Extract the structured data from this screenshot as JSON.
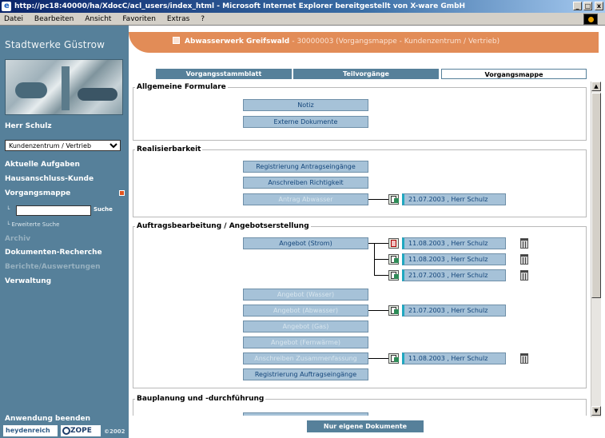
{
  "window": {
    "title": "http://pc18:40000/ha/XdocC/acl_users/index_html - Microsoft Internet Explorer bereitgestellt von X-ware GmbH",
    "minimize": "_",
    "maximize": "□",
    "close": "x"
  },
  "menu": {
    "items": [
      "Datei",
      "Bearbeiten",
      "Ansicht",
      "Favoriten",
      "Extras",
      "?"
    ]
  },
  "sidebar": {
    "brand": "Stadtwerke Güstrow",
    "user": "Herr Schulz",
    "select_value": "Kundenzentrum / Vertrieb",
    "nav": {
      "aktuelle_aufgaben": "Aktuelle Aufgaben",
      "hausanschluss": "Hausanschluss-Kunde",
      "vorgangsmappe": "Vorgangsmappe",
      "search_button": "Suche",
      "erweiterte_suche": "Erweiterte Suche",
      "archiv": "Archiv",
      "dokumenten_recherche": "Dokumenten-Recherche",
      "berichte": "Berichte/Auswertungen",
      "verwaltung": "Verwaltung"
    },
    "exit": "Anwendung beenden",
    "logo1": "heydenreich",
    "logo2": "ZOPE",
    "year": "©2002"
  },
  "header": {
    "title": "Abwasserwerk Greifswald",
    "subtitle": "- 30000003 (Vorgangsmappe - Kundenzentrum / Vertrieb)",
    "accent": "#e28c57"
  },
  "tabs": [
    {
      "label": "Vorgangsstammblatt",
      "active": false
    },
    {
      "label": "Teilvorgänge",
      "active": false
    },
    {
      "label": "Vorgangsmappe",
      "active": true
    }
  ],
  "groups": {
    "allgemein": {
      "title": "Allgemeine Formulare",
      "buttons": [
        "Notiz",
        "Externe Dokumente"
      ]
    },
    "realisierbarkeit": {
      "title": "Realisierbarkeit",
      "buttons": [
        "Registrierung Antragseingänge",
        "Anschreiben Richtigkeit",
        "Antrag Abwasser"
      ],
      "entries": [
        "21.07.2003 , Herr Schulz"
      ]
    },
    "auftrag": {
      "title": "Auftragsbearbeitung / Angebotserstellung",
      "buttons": [
        "Angebot (Strom)",
        "Angebot (Wasser)",
        "Angebot (Abwasser)",
        "Angebot (Gas)",
        "Angebot (Fernwärme)",
        "Anschreiben Zusammenfassung",
        "Registrierung Auftragseingänge"
      ],
      "entries": [
        "11.08.2003 , Herr Schulz",
        "11.08.2003 , Herr Schulz",
        "21.07.2003 , Herr Schulz",
        "21.07.2003 , Herr Schulz",
        "11.08.2003 , Herr Schulz"
      ]
    },
    "bauplanung": {
      "title": "Bauplanung und -durchführung"
    }
  },
  "footer": {
    "button": "Nur eigene Dokumente"
  },
  "scrollbar": {
    "up": "▲",
    "down": "▼"
  },
  "colors": {
    "sidebar": "#56809a",
    "button": "#a6c2d8",
    "accent_bar": "#20a8c0"
  }
}
